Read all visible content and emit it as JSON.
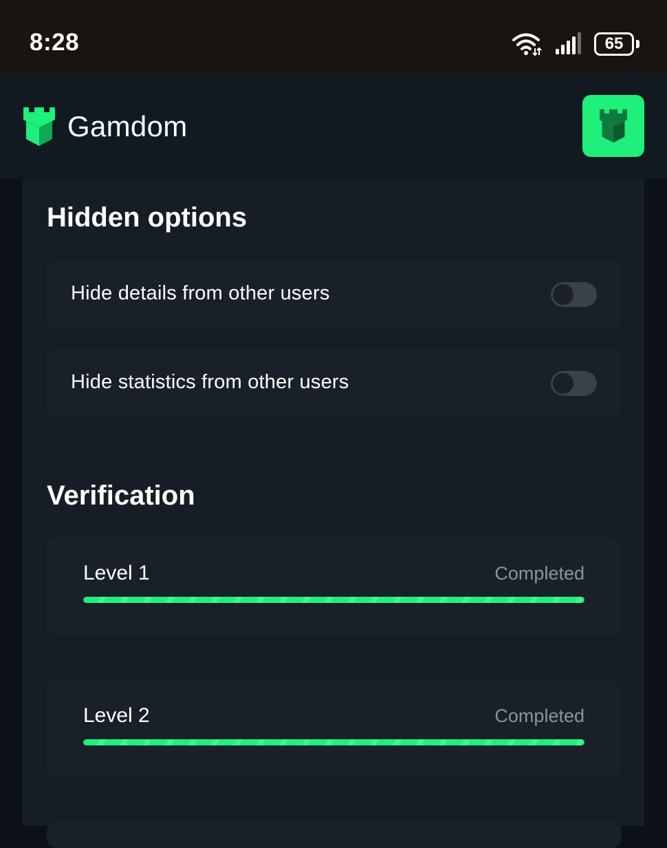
{
  "status_bar": {
    "time": "8:28",
    "battery": "65",
    "wifi_icon": "wifi-icon",
    "signal_icon": "cellular-signal-icon"
  },
  "header": {
    "brand_name": "Gamdom",
    "logo_icon": "castle-tower-icon",
    "action_icon": "castle-tower-icon"
  },
  "hidden_options": {
    "title": "Hidden options",
    "items": [
      {
        "label": "Hide details from other users",
        "enabled": false
      },
      {
        "label": "Hide statistics from other users",
        "enabled": false
      }
    ]
  },
  "verification": {
    "title": "Verification",
    "levels": [
      {
        "label": "Level 1",
        "status": "Completed",
        "progress": 1.0
      },
      {
        "label": "Level 2",
        "status": "Completed",
        "progress": 1.0
      }
    ]
  },
  "colors": {
    "accent": "#1ef07b",
    "background": "#0c1117",
    "panel": "#161d25",
    "card": "#1a2028",
    "muted_text": "#8a949d"
  }
}
